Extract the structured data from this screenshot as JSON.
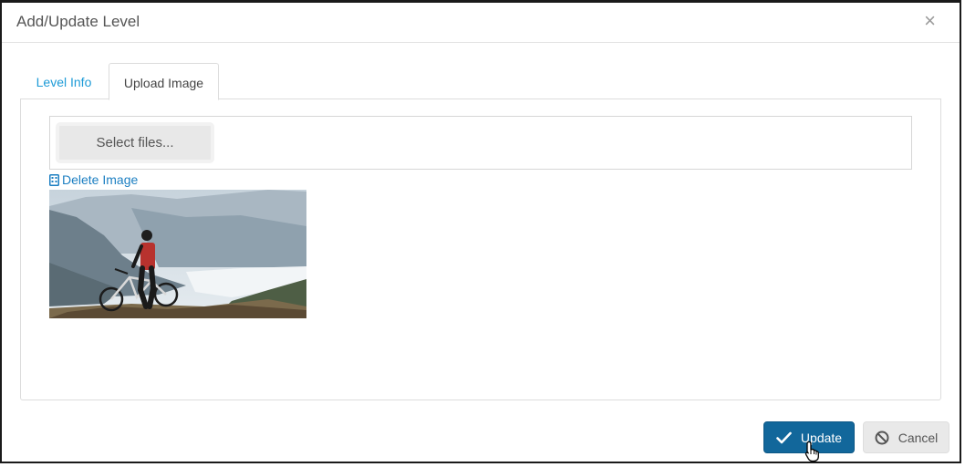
{
  "dialog": {
    "title": "Add/Update Level",
    "close_label": "×"
  },
  "tabs": [
    {
      "label": "Level Info",
      "active": false
    },
    {
      "label": "Upload Image",
      "active": true
    }
  ],
  "upload": {
    "select_label": "Select files...",
    "delete_label": "Delete Image"
  },
  "footer": {
    "update_label": "Update",
    "cancel_label": "Cancel"
  },
  "icons": {
    "close": "close-icon",
    "delete": "trash-icon",
    "update": "checkmark-icon",
    "cancel": "ban-icon",
    "cursor": "hand-pointer-cursor"
  },
  "colors": {
    "tab_link": "#1e9bd7",
    "link": "#1c7fc2",
    "primary_button": "#12679b"
  }
}
